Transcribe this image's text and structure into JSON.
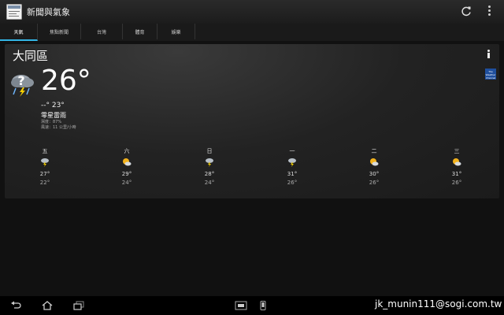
{
  "app": {
    "title": "新聞與氣象"
  },
  "tabs": [
    {
      "label": "天氣"
    },
    {
      "label": "焦點新聞"
    },
    {
      "label": "台灣"
    },
    {
      "label": "體育"
    },
    {
      "label": "娛樂"
    }
  ],
  "weather": {
    "city": "大同區",
    "current_temp": "26°",
    "high_low": "--° 23°",
    "condition": "零星雷雨",
    "humidity": "濕度：87%",
    "wind": "風速：11 公里/小時",
    "provider": "The Weather Channel",
    "forecast": [
      {
        "day": "五",
        "icon": "thunderstorm-icon",
        "high": "27°",
        "low": "22°"
      },
      {
        "day": "六",
        "icon": "partly-cloudy-icon",
        "high": "29°",
        "low": "24°"
      },
      {
        "day": "日",
        "icon": "thunderstorm-icon",
        "high": "28°",
        "low": "24°"
      },
      {
        "day": "一",
        "icon": "thunderstorm-icon",
        "high": "31°",
        "low": "26°"
      },
      {
        "day": "二",
        "icon": "partly-cloudy-icon",
        "high": "30°",
        "low": "26°"
      },
      {
        "day": "三",
        "icon": "partly-cloudy-icon",
        "high": "31°",
        "low": "26°"
      }
    ]
  },
  "watermark": "jk_munin111@sogi.com.tw",
  "colors": {
    "accent": "#33b5e5",
    "sun": "#f2b21c",
    "cloud": "#b8c0c8"
  }
}
